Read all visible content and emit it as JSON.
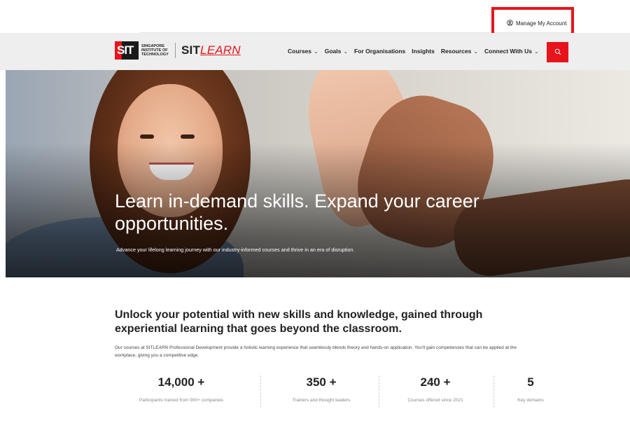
{
  "header": {
    "account_label": "Manage My Account",
    "logo_sit": "SIT",
    "logo_institute": "SINGAPORE INSTITUTE OF TECHNOLOGY",
    "brand_prefix": "SIT",
    "brand_suffix": "LEARN"
  },
  "nav": {
    "items": [
      {
        "label": "Courses",
        "dropdown": true
      },
      {
        "label": "Goals",
        "dropdown": true
      },
      {
        "label": "For Organisations",
        "dropdown": false
      },
      {
        "label": "Insights",
        "dropdown": false
      },
      {
        "label": "Resources",
        "dropdown": true
      },
      {
        "label": "Connect With Us",
        "dropdown": true
      }
    ],
    "search_icon": "search-icon"
  },
  "hero": {
    "title": "Learn in-demand skills. Expand your career opportunities.",
    "subtitle": "Advance your lifelong learning journey with our industry-informed courses and thrive in an era of disruption."
  },
  "intro": {
    "heading": "Unlock your potential with new skills and knowledge, gained through experiential learning that goes beyond the classroom.",
    "text_before": "Our courses at SIT",
    "text_em": "LEARN",
    "text_after": " Professional Development provide a holistic learning experience that seamlessly blends theory and hands-on application. You'll gain competencies that can be applied at the workplace, giving you a competitive edge."
  },
  "stats": [
    {
      "value": "14,000 +",
      "label": "Participants trained from 900+ companies"
    },
    {
      "value": "350 +",
      "label": "Trainers and thought leaders"
    },
    {
      "value": "240 +",
      "label": "Courses offered since 2021"
    },
    {
      "value": "5",
      "label": "Key domains"
    }
  ],
  "colors": {
    "accent": "#e8141c",
    "nav_bg": "#eeeeee",
    "text": "#222222"
  }
}
